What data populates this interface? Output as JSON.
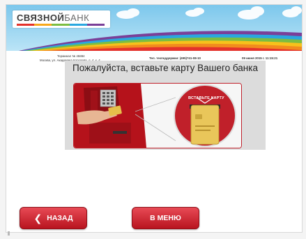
{
  "brand": {
    "name_part1": "СВЯЗНОЙ",
    "name_part2": "БАНК",
    "stripe_colors": [
      "#e4322b",
      "#f7a81b",
      "#7bbd42",
      "#2aa7df",
      "#7a3f98"
    ]
  },
  "info": {
    "terminal": "Терминал № 45884",
    "address": "Москва, ул. Академика Королева, д. 4, к. 4",
    "support": "Тел. техподдержки: (495)741-08-10",
    "datetime": "09 июня 2015 г. 11:15:21"
  },
  "main": {
    "title": "Пожалуйста, вставьте карту Вашего банка",
    "insert_card_label": "ВСТАВЬТЕ КАРТУ"
  },
  "buttons": {
    "back": "НАЗАД",
    "back_icon": "chevron-left-icon",
    "menu": "В МЕНЮ"
  },
  "colors": {
    "accent": "#c0202a",
    "sky": "#8fd0ef"
  }
}
